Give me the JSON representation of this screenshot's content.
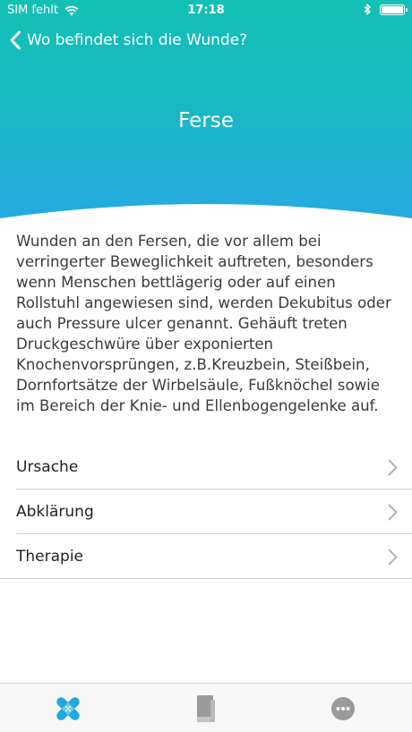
{
  "status_bar": {
    "carrier": "SIM fehlt",
    "time": "17:18"
  },
  "nav": {
    "back_label": "Wo befindet sich die Wunde?"
  },
  "page": {
    "title": "Ferse",
    "description": "Wunden an den Fersen, die vor allem bei verringerter Beweglichkeit auftreten, besonders wenn Menschen bettlägerig oder auf einen Rollstuhl angewiesen sind, werden Dekubitus oder auch Pressure ulcer genannt. Gehäuft treten Druckgeschwüre über exponierten Knochenvorsprüngen, z.B.Kreuzbein, Steißbein, Dornfortsätze der Wirbelsäule, Fußknöchel sowie im Bereich der Knie- und Ellenbogengelenke auf."
  },
  "menu": {
    "items": [
      {
        "label": "Ursache"
      },
      {
        "label": "Abklärung"
      },
      {
        "label": "Therapie"
      }
    ]
  },
  "tab_bar": {
    "tabs": [
      {
        "icon": "bandage-icon",
        "active": true
      },
      {
        "icon": "book-icon",
        "active": false
      },
      {
        "icon": "more-icon",
        "active": false
      }
    ]
  },
  "colors": {
    "header_top": "#13c0b4",
    "header_bottom": "#26a9e3",
    "active_tab": "#23a7e0",
    "inactive_tab": "#9b9b9b"
  }
}
